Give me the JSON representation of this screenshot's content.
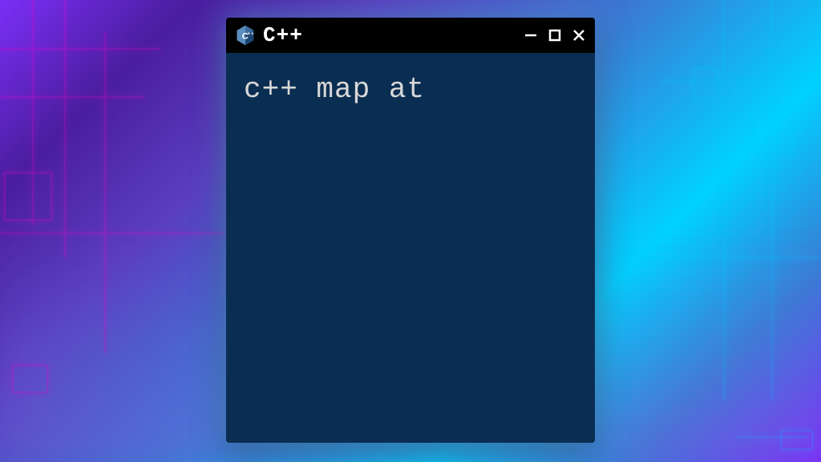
{
  "window": {
    "title": "C++",
    "content": "c++ map at"
  }
}
